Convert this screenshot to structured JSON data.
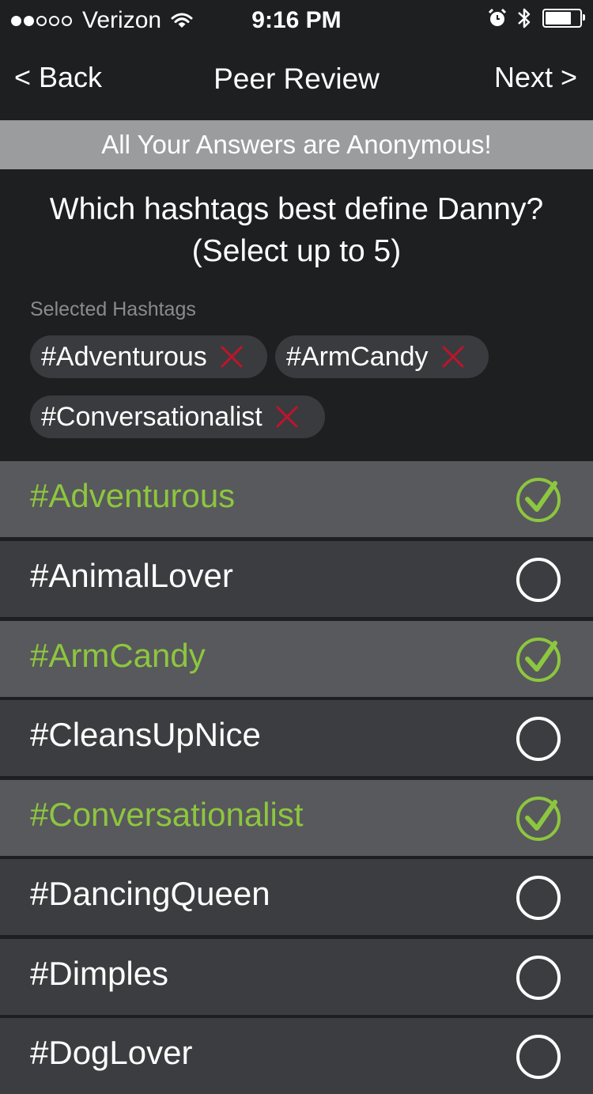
{
  "status_bar": {
    "carrier": "Verizon",
    "time": "9:16 PM",
    "signal_bars_filled": 2,
    "signal_bars_total": 5,
    "battery_level": 0.7
  },
  "nav": {
    "back_label": "< Back",
    "title": "Peer Review",
    "next_label": "Next >"
  },
  "banner": {
    "text": "All Your Answers are Anonymous!"
  },
  "question": {
    "line1": "Which hashtags best define Danny?",
    "line2": "(Select up to 5)"
  },
  "selected": {
    "label": "Selected Hashtags",
    "chips": [
      {
        "label": "#Adventurous"
      },
      {
        "label": "#ArmCandy"
      },
      {
        "label": "#Conversationalist"
      }
    ]
  },
  "hashtags": [
    {
      "label": "#Adventurous",
      "selected": true
    },
    {
      "label": "#AnimalLover",
      "selected": false
    },
    {
      "label": "#ArmCandy",
      "selected": true
    },
    {
      "label": "#CleansUpNice",
      "selected": false
    },
    {
      "label": "#Conversationalist",
      "selected": true
    },
    {
      "label": "#DancingQueen",
      "selected": false
    },
    {
      "label": "#Dimples",
      "selected": false
    },
    {
      "label": "#DogLover",
      "selected": false
    }
  ],
  "colors": {
    "accent_green": "#8dc63f",
    "remove_red": "#c0142a",
    "selected_row": "#58595c",
    "unselected_row": "#3c3d40",
    "background": "#1e1f21"
  }
}
